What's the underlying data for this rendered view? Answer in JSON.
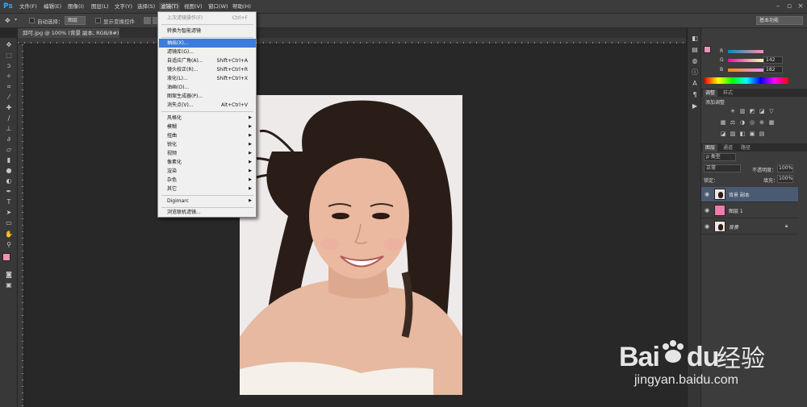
{
  "app": {
    "logo": "Ps"
  },
  "menubar": {
    "items": [
      "文件(F)",
      "编辑(E)",
      "图像(I)",
      "图层(L)",
      "文字(Y)",
      "选择(S)",
      "滤镜(T)",
      "视图(V)",
      "窗口(W)",
      "帮助(H)"
    ]
  },
  "optionsbar": {
    "auto_select_label": "自动选择：",
    "auto_select_value": "图层",
    "show_transform_label": "显示变换控件",
    "workspace": "基本功能"
  },
  "document_tab": {
    "title": "邱可.jpg @ 100% (背景 副本, RGB/8#) *",
    "close": "×"
  },
  "filter_menu": {
    "items": [
      {
        "label": "上次滤镜操作(F)",
        "shortcut": "Ctrl+F",
        "disabled": true
      },
      {
        "label": "转换为智能滤镜",
        "shortcut": ""
      },
      {
        "label": "抽出(X)...",
        "shortcut": "",
        "highlighted": true
      },
      {
        "label": "滤镜库(G)...",
        "shortcut": ""
      },
      {
        "label": "自适应广角(A)...",
        "shortcut": "Shift+Ctrl+A"
      },
      {
        "label": "镜头校正(R)...",
        "shortcut": "Shift+Ctrl+R"
      },
      {
        "label": "液化(L)...",
        "shortcut": "Shift+Ctrl+X"
      },
      {
        "label": "油画(O)...",
        "shortcut": ""
      },
      {
        "label": "图案生成器(P)...",
        "shortcut": ""
      },
      {
        "label": "消失点(V)...",
        "shortcut": "Alt+Ctrl+V"
      },
      {
        "label": "风格化",
        "submenu": true
      },
      {
        "label": "模糊",
        "submenu": true
      },
      {
        "label": "扭曲",
        "submenu": true
      },
      {
        "label": "锐化",
        "submenu": true
      },
      {
        "label": "视频",
        "submenu": true
      },
      {
        "label": "像素化",
        "submenu": true
      },
      {
        "label": "渲染",
        "submenu": true
      },
      {
        "label": "杂色",
        "submenu": true
      },
      {
        "label": "其它",
        "submenu": true
      },
      {
        "label": "Digimarc",
        "submenu": true
      },
      {
        "label": "浏览联机滤镜..."
      }
    ]
  },
  "color_panel": {
    "g_label": "G",
    "g_value": "142",
    "b_label": "B",
    "b_value": "182"
  },
  "adjust_panel": {
    "tabs": [
      "调整",
      "样式"
    ],
    "title": "添加调整"
  },
  "layers_panel": {
    "tabs": [
      "图层",
      "通道",
      "路径"
    ],
    "kind": "ρ 类型",
    "blend_mode": "正常",
    "opacity_label": "不透明度：",
    "opacity_value": "100%",
    "lock_label": "锁定：",
    "fill_label": "填充：",
    "fill_value": "100%",
    "layers": [
      {
        "name": "背景 副本",
        "selected": true,
        "thumb": "photo"
      },
      {
        "name": "图层 1",
        "selected": false,
        "thumb": "pink"
      },
      {
        "name": "背景",
        "selected": false,
        "thumb": "photo",
        "locked": true
      }
    ]
  },
  "colors": {
    "foreground": "#f58fb8",
    "background": "#ffffff",
    "pink_layer": "#f07aab",
    "highlight": "#3b7ddc"
  },
  "watermark": {
    "brand": "Bai",
    "brand2": "du",
    "cn": "经验",
    "url": "jingyan.baidu.com"
  }
}
